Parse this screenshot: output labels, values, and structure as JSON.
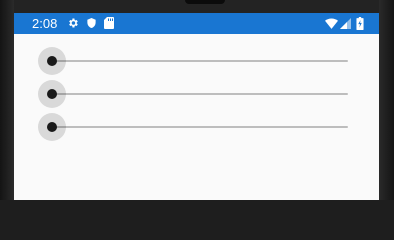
{
  "status_bar": {
    "time": "2:08",
    "background": "#1976d2",
    "left_icons": [
      "gear-icon",
      "shield-icon",
      "sd-card-icon"
    ],
    "right_icons": [
      "wifi-icon",
      "signal-icon",
      "battery-charging-icon"
    ]
  },
  "sliders": [
    {
      "value": 0
    },
    {
      "value": 0
    },
    {
      "value": 0
    }
  ],
  "colors": {
    "thumb": "#1a1a1a",
    "track": "#bdbdbd",
    "screen": "#fafafa"
  }
}
